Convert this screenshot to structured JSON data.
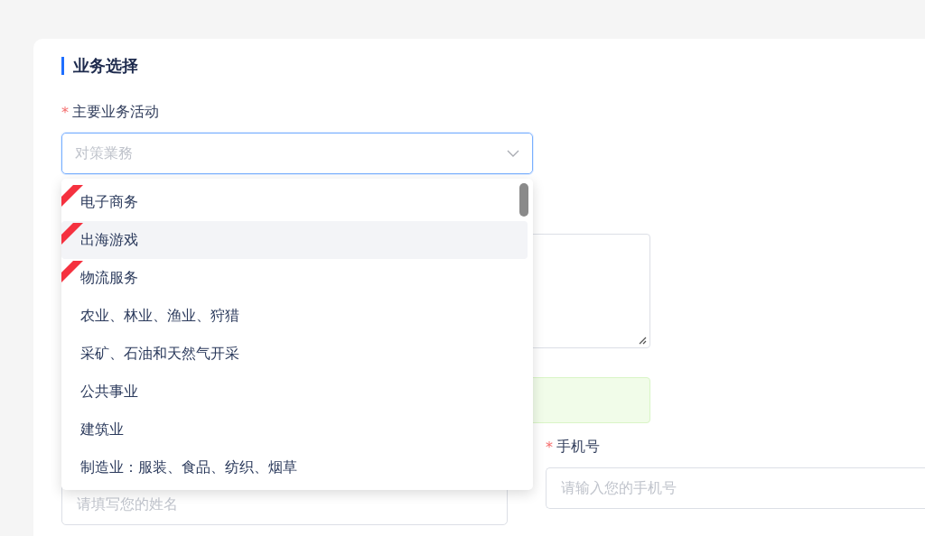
{
  "section": {
    "title": "业务选择"
  },
  "main_activity": {
    "label": "主要业务活动",
    "required_mark": "*",
    "placeholder": "对策業務",
    "open": true
  },
  "dropdown": {
    "items": [
      {
        "label": "电子商务",
        "tagged": true,
        "highlighted": false
      },
      {
        "label": "出海游戏",
        "tagged": true,
        "highlighted": true
      },
      {
        "label": "物流服务",
        "tagged": true,
        "highlighted": false
      },
      {
        "label": "农业、林业、渔业、狩猎",
        "tagged": false,
        "highlighted": false
      },
      {
        "label": "采矿、石油和天然气开采",
        "tagged": false,
        "highlighted": false
      },
      {
        "label": "公共事业",
        "tagged": false,
        "highlighted": false
      },
      {
        "label": "建筑业",
        "tagged": false,
        "highlighted": false
      },
      {
        "label": "制造业：服装、食品、纺织、烟草",
        "tagged": false,
        "highlighted": false
      }
    ]
  },
  "name_field": {
    "placeholder": "请填写您的姓名"
  },
  "phone_field": {
    "label": "手机号",
    "required_mark": "*",
    "placeholder": "请输入您的手机号"
  }
}
